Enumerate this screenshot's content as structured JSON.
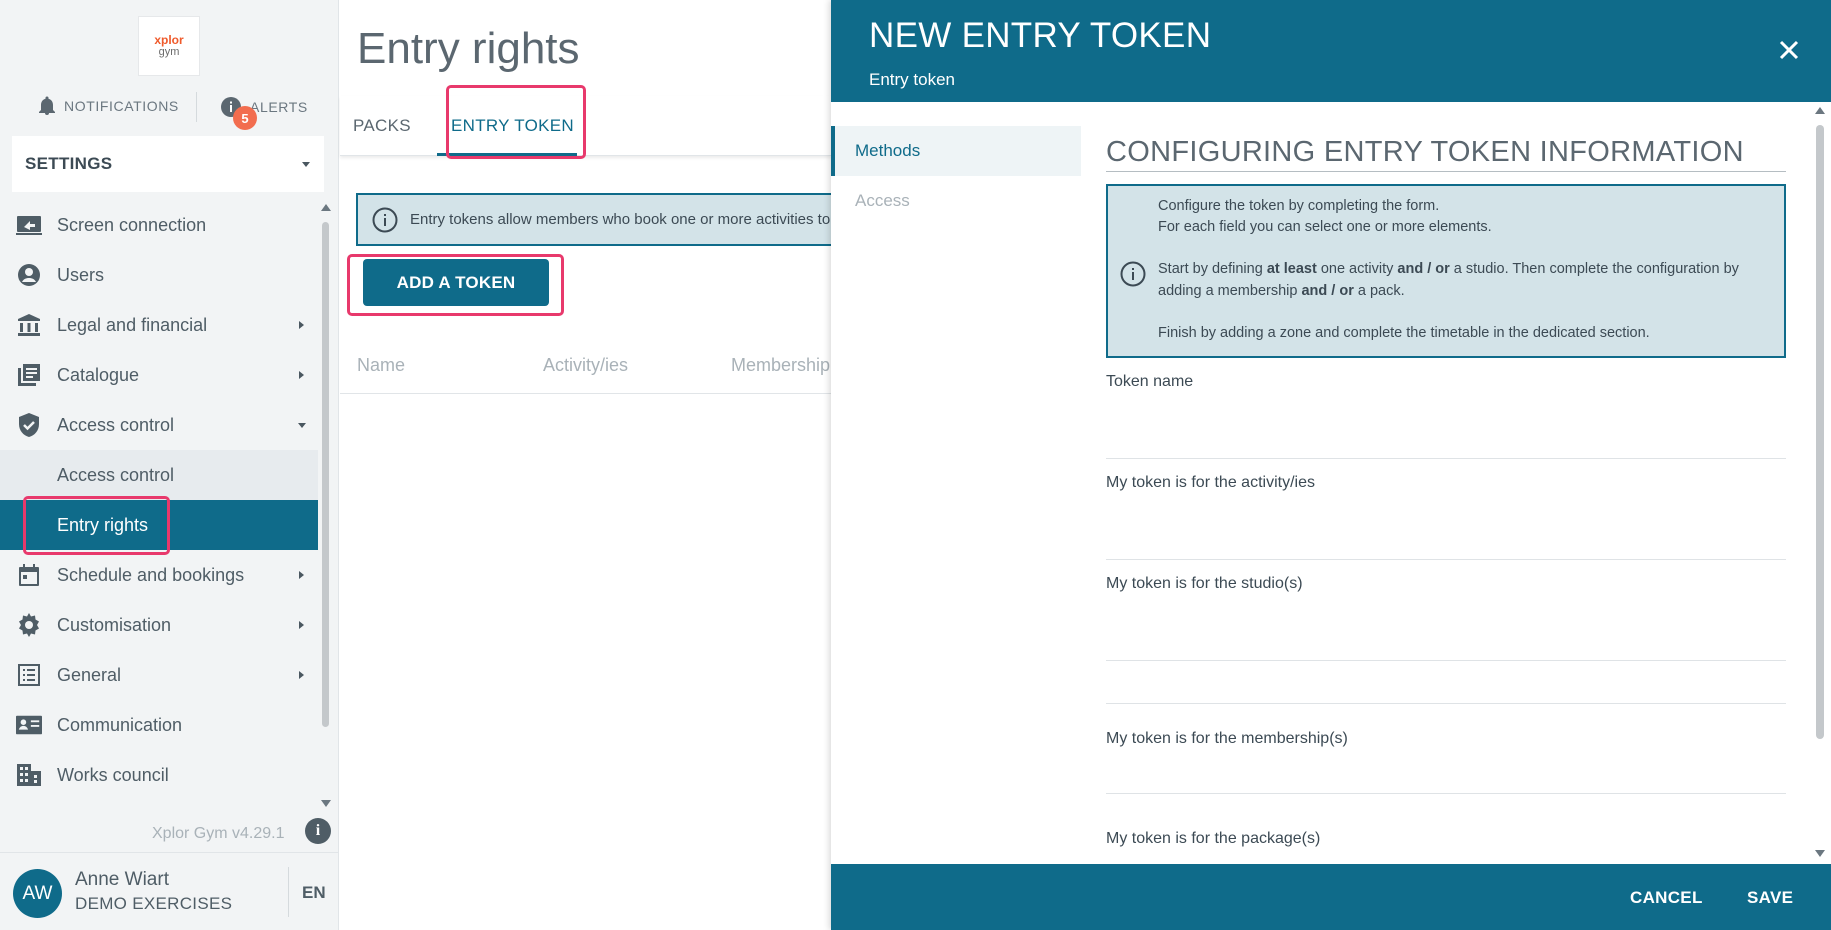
{
  "app": {
    "logo_line1": "xplor",
    "logo_line2": "gym",
    "notifications_label": "NOTIFICATIONS",
    "alerts_label": "ALERTS",
    "alerts_count": "5",
    "settings_label": "SETTINGS",
    "version": "Xplor Gym v4.29.1"
  },
  "sidebar": {
    "items": [
      {
        "label": "Screen connection",
        "icon": "screen-connection-icon"
      },
      {
        "label": "Users",
        "icon": "user-circle-icon"
      },
      {
        "label": "Legal and financial",
        "icon": "bank-icon"
      },
      {
        "label": "Catalogue",
        "icon": "catalogue-icon"
      },
      {
        "label": "Access control",
        "icon": "shield-check-icon"
      },
      {
        "label": "Access control"
      },
      {
        "label": "Entry rights"
      },
      {
        "label": "Schedule and bookings",
        "icon": "calendar-icon"
      },
      {
        "label": "Customisation",
        "icon": "gear-icon"
      },
      {
        "label": "General",
        "icon": "list-icon"
      },
      {
        "label": "Communication",
        "icon": "contact-card-icon"
      },
      {
        "label": "Works council",
        "icon": "building-icon"
      }
    ]
  },
  "user": {
    "initials": "AW",
    "name": "Anne Wiart",
    "org": "DEMO EXERCISES",
    "lang": "EN"
  },
  "main": {
    "title": "Entry rights",
    "tabs": [
      {
        "label": "PACKS"
      },
      {
        "label": "ENTRY TOKEN"
      }
    ],
    "info_text": "Entry tokens allow members who book one or more activities to e",
    "add_button": "ADD A TOKEN",
    "columns": [
      "Name",
      "Activity/ies",
      "Membership("
    ]
  },
  "panel": {
    "title": "NEW ENTRY TOKEN",
    "subtitle": "Entry token",
    "nav": [
      {
        "label": "Methods"
      },
      {
        "label": "Access"
      }
    ],
    "section_title": "CONFIGURING ENTRY TOKEN INFORMATION",
    "info": {
      "line1": "Configure the token by completing the form.",
      "line2": "For each field you can select one or more elements.",
      "line3_a": "Start by defining ",
      "line3_b": "at least",
      "line3_c": " one activity ",
      "line3_d": "and / or",
      "line3_e": " a studio. Then complete the configuration by",
      "line4_a": "adding a membership ",
      "line4_b": "and / or",
      "line4_c": " a pack.",
      "line5": "Finish by adding a zone and complete the timetable in the dedicated section."
    },
    "fields": [
      {
        "label": "Token name"
      },
      {
        "label": "My token is for the activity/ies"
      },
      {
        "label": "My token is for the studio(s)"
      },
      {
        "label": "My token is for the membership(s)"
      },
      {
        "label": "My token is for the package(s)"
      }
    ],
    "cancel": "CANCEL",
    "save": "SAVE"
  },
  "colors": {
    "primary": "#0f6b8a",
    "highlight": "#e8396c",
    "badge": "#f26d4f",
    "info_bg": "#d3e3e8"
  }
}
